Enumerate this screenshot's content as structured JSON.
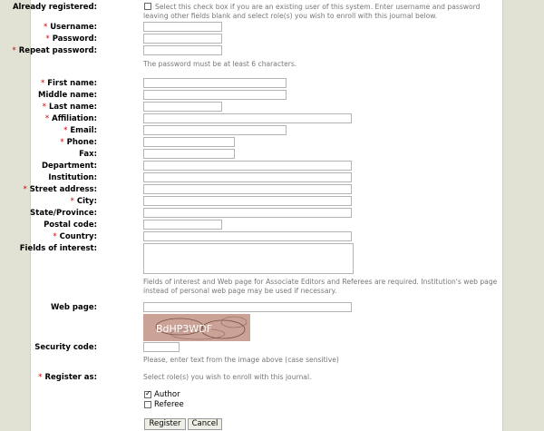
{
  "form": {
    "already_registered": {
      "label": "Already registered:",
      "note": "Select this check box if you are an existing user of this system. Enter username and password leaving other fields blank and select role(s) you wish to enroll with this journal below."
    },
    "required_mark": "*",
    "fields": [
      {
        "label": "Username:",
        "required": true
      },
      {
        "label": "Password:",
        "required": true
      },
      {
        "label": "Repeat password:",
        "required": true
      },
      {
        "label": "First name:",
        "required": true
      },
      {
        "label": "Middle name:",
        "required": false
      },
      {
        "label": "Last name:",
        "required": true
      },
      {
        "label": "Affiliation:",
        "required": true
      },
      {
        "label": "Email:",
        "required": true
      },
      {
        "label": "Phone:",
        "required": true
      },
      {
        "label": "Fax:",
        "required": false
      },
      {
        "label": "Department:",
        "required": false
      },
      {
        "label": "Institution:",
        "required": false
      },
      {
        "label": "Street address:",
        "required": true
      },
      {
        "label": "City:",
        "required": true
      },
      {
        "label": "State/Province:",
        "required": false
      },
      {
        "label": "Postal code:",
        "required": false
      },
      {
        "label": "Country:",
        "required": true
      },
      {
        "label": "Fields of interest:",
        "required": false
      }
    ],
    "password_note": "The password must be at least 6 characters.",
    "interest_note": "Fields of interest and Web page for Associate Editors and Referees are required. Institution's web page instead of personal web page may be used if necessary.",
    "web_page_label": "Web page:",
    "captcha_text": "BdHP3WDF",
    "security_code_label": "Security code:",
    "security_note": "Please, enter text from the image above (case sensitive)",
    "register_as": {
      "label": "Register as:",
      "note": "Select role(s) you wish to enroll with this journal.",
      "options": [
        {
          "label": "Author",
          "checked": true
        },
        {
          "label": "Referee",
          "checked": false
        }
      ]
    },
    "buttons": {
      "register": "Register",
      "cancel": "Cancel"
    }
  },
  "colors": {
    "background": "#e2e2d4",
    "required": "#cc0000",
    "note": "#777777",
    "captcha": "#caa396"
  }
}
